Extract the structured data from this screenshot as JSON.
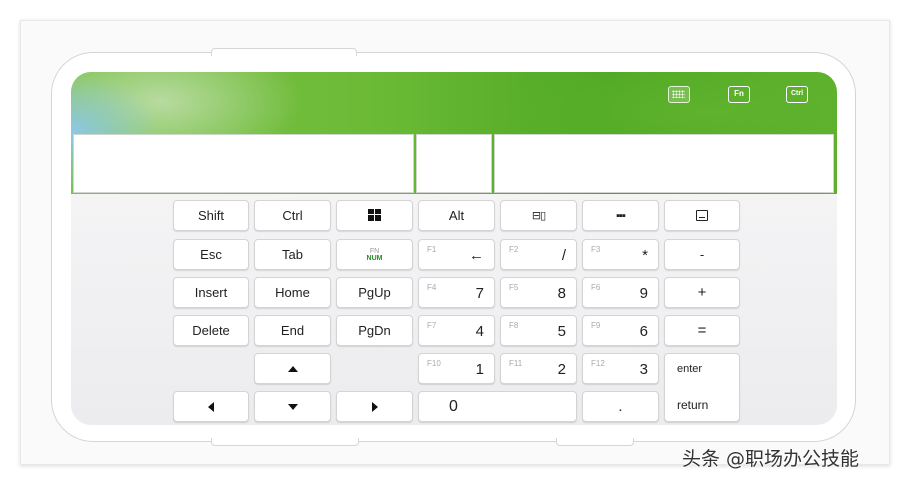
{
  "header_icons": [
    {
      "name": "keyboard-icon",
      "label": ""
    },
    {
      "name": "fn-icon",
      "label": "Fn"
    },
    {
      "name": "ctrl-icon",
      "label": "Ctrl"
    }
  ],
  "keys": {
    "shift": "Shift",
    "ctrl": "Ctrl",
    "alt": "Alt",
    "esc": "Esc",
    "tab": "Tab",
    "insert": "Insert",
    "home": "Home",
    "pgup": "PgUp",
    "delete": "Delete",
    "end": "End",
    "pgdn": "PgDn",
    "minus": "-",
    "plus": "+",
    "equals": "=",
    "enter": "enter",
    "return": "return",
    "dot": ".",
    "zero": "0",
    "fn_numlock_top": "FN",
    "fn_numlock_bottom": "NUM",
    "f1": {
      "f": "F1",
      "v": "←"
    },
    "f2": {
      "f": "F2",
      "v": "/"
    },
    "f3": {
      "f": "F3",
      "v": "*"
    },
    "f4": {
      "f": "F4",
      "v": "7"
    },
    "f5": {
      "f": "F5",
      "v": "8"
    },
    "f6": {
      "f": "F6",
      "v": "9"
    },
    "f7": {
      "f": "F7",
      "v": "4"
    },
    "f8": {
      "f": "F8",
      "v": "5"
    },
    "f9": {
      "f": "F9",
      "v": "6"
    },
    "f10": {
      "f": "F10",
      "v": "1"
    },
    "f11": {
      "f": "F11",
      "v": "2"
    },
    "f12": {
      "f": "F12",
      "v": "3"
    }
  },
  "watermark": "头条 @职场办公技能"
}
